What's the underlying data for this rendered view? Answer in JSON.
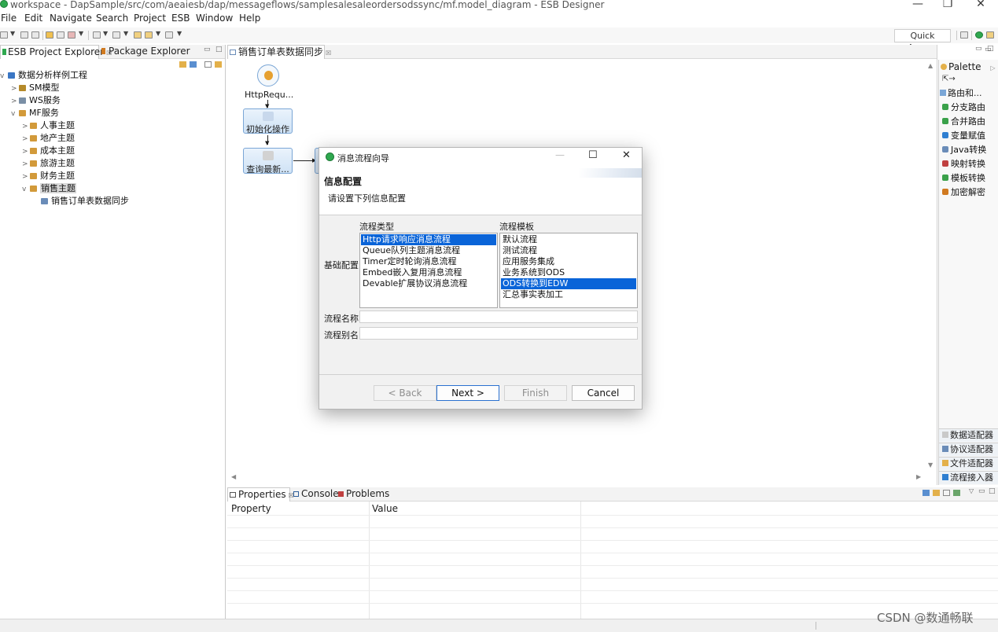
{
  "window": {
    "title": "workspace - DapSample/src/com/aeaiesb/dap/messageflows/samplesalesaleordersodssync/mf.model_diagram - ESB Designer",
    "minimize": "—",
    "restore": "❐",
    "close": "✕"
  },
  "menu": [
    "File",
    "Edit",
    "Navigate",
    "Search",
    "Project",
    "ESB",
    "Window",
    "Help"
  ],
  "toolbar": {
    "quick_access": "Quick Access"
  },
  "explorer": {
    "tabs": [
      {
        "label": "ESB Project Explorer",
        "close": "☒"
      },
      {
        "label": "Package Explorer"
      }
    ],
    "tree": [
      {
        "label": "数据分析样例工程",
        "arrow": "v",
        "color": "#3a76c4"
      },
      {
        "label": "SM模型",
        "arrow": ">",
        "color": "#b58a2a"
      },
      {
        "label": "WS服务",
        "arrow": ">",
        "color": "#7a8fa6"
      },
      {
        "label": "MF服务",
        "arrow": "v",
        "color": "#d29a3a"
      },
      {
        "label": "人事主题",
        "arrow": ">",
        "color": "#d29a3a"
      },
      {
        "label": "地产主题",
        "arrow": ">",
        "color": "#d29a3a"
      },
      {
        "label": "成本主题",
        "arrow": ">",
        "color": "#d29a3a"
      },
      {
        "label": "旅游主题",
        "arrow": ">",
        "color": "#d29a3a"
      },
      {
        "label": "财务主题",
        "arrow": ">",
        "color": "#d29a3a"
      },
      {
        "label": "销售主题",
        "arrow": "v",
        "color": "#d29a3a"
      },
      {
        "label": "销售订单表数据同步",
        "arrow": "",
        "color": "#6a8cb8"
      }
    ]
  },
  "editor": {
    "tab": {
      "label": "销售订单表数据同步",
      "close": "☒"
    },
    "nodes": {
      "http": "HttpRequ...",
      "init": "初始化操作",
      "query": "查询最新..."
    }
  },
  "palette": {
    "title": "Palette",
    "group": "路由和...",
    "items": [
      {
        "label": "分支路由",
        "color": "#3aa14a"
      },
      {
        "label": "合并路由",
        "color": "#3aa14a"
      },
      {
        "label": "变量赋值",
        "color": "#2f7fd1"
      },
      {
        "label": "Java转换",
        "color": "#6a8cb8"
      },
      {
        "label": "映射转换",
        "color": "#c04040"
      },
      {
        "label": "模板转换",
        "color": "#3aa14a"
      },
      {
        "label": "加密解密",
        "color": "#d07a20"
      }
    ],
    "sections": [
      "数据适配器",
      "协议适配器",
      "文件适配器",
      "流程接入器"
    ]
  },
  "bottom": {
    "tabs": [
      {
        "label": "Properties",
        "close": "☒"
      },
      {
        "label": "Console"
      },
      {
        "label": "Problems"
      }
    ],
    "columns": [
      "Property",
      "Value"
    ]
  },
  "dialog": {
    "title": "消息流程向导",
    "heading": "信息配置",
    "subtitle": "请设置下列信息配置",
    "flow_type_label": "流程类型",
    "flow_template_label": "流程模板",
    "basic_config_label": "基础配置",
    "flow_types": [
      "Http请求响应消息流程",
      "Queue队列主题消息流程",
      "Timer定时轮询消息流程",
      "Embed嵌入复用消息流程",
      "Devable扩展协议消息流程"
    ],
    "flow_type_selected": 0,
    "templates": [
      "默认流程",
      "测试流程",
      "应用服务集成",
      "业务系统到ODS",
      "ODS转换到EDW",
      "汇总事实表加工"
    ],
    "template_selected": 4,
    "flow_name_label": "流程名称",
    "flow_name_value": "",
    "flow_alias_label": "流程别名",
    "flow_alias_value": "",
    "buttons": {
      "back": "< Back",
      "next": "Next >",
      "finish": "Finish",
      "cancel": "Cancel"
    },
    "minimize": "—",
    "maximize": "☐",
    "close": "✕"
  },
  "watermark": "CSDN @数通畅联",
  "colors": {
    "selection": "#0a64d8",
    "node_border": "#7aa6d6",
    "dialog_icon": "#2fa84f"
  }
}
